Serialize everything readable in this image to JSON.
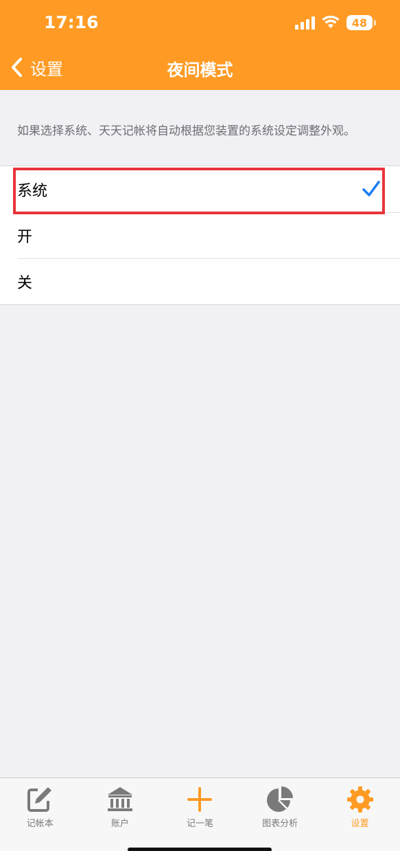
{
  "status_bar": {
    "time": "17:16",
    "battery": "48"
  },
  "nav": {
    "back_label": "设置",
    "title": "夜间模式"
  },
  "description": "如果选择系统、天天记帐将自动根据您装置的系统设定调整外观。",
  "options": [
    {
      "label": "系统",
      "selected": true
    },
    {
      "label": "开",
      "selected": false
    },
    {
      "label": "关",
      "selected": false
    }
  ],
  "tabbar": {
    "items": [
      {
        "label": "记帐本",
        "icon": "edit-icon"
      },
      {
        "label": "账户",
        "icon": "bank-icon"
      },
      {
        "label": "记一笔",
        "icon": "plus-icon"
      },
      {
        "label": "图表分析",
        "icon": "pie-chart-icon"
      },
      {
        "label": "设置",
        "icon": "gear-icon",
        "active": true
      }
    ]
  },
  "colors": {
    "accent": "#ff9b24",
    "check": "#1a7cf5",
    "highlight": "#e8343c",
    "tab_inactive": "#7a7a7a"
  }
}
